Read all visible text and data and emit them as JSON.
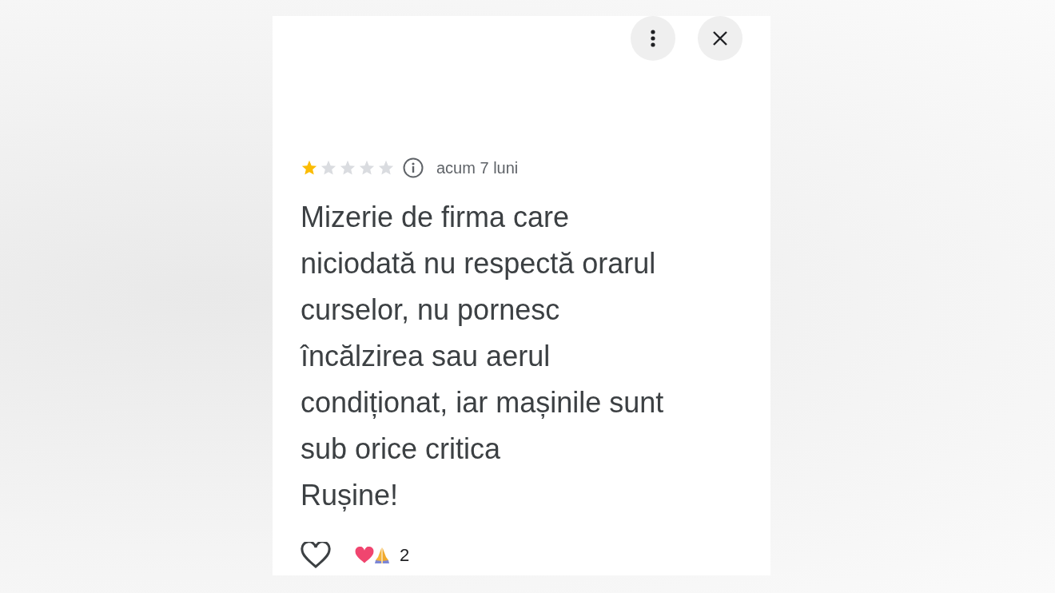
{
  "review": {
    "stars": 1,
    "time": "acum 7 luni",
    "text": "Mizerie de firma care\nniciodată nu respectă orarul\ncurselor, nu pornesc\nîncălzirea sau aerul\ncondiționat, iar mașinile sunt\nsub orice critica\nRușine!",
    "liked": false,
    "reaction_count": "2"
  }
}
